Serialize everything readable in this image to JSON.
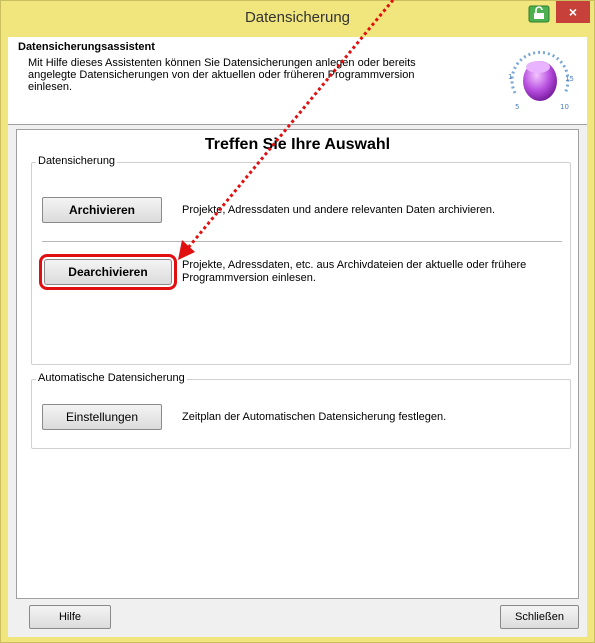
{
  "window": {
    "title": "Datensicherung",
    "close_glyph": "×"
  },
  "header": {
    "title": "Datensicherungsassistent",
    "description": "Mit Hilfe dieses Assistenten können Sie Datensicherungen anlegen oder bereits angelegte Datensicherungen von der aktuellen oder früheren Programmversion einlesen.",
    "dial_labels": [
      "1",
      "5",
      "10",
      "15"
    ]
  },
  "content": {
    "choice_title": "Treffen Sie Ihre Auswahl",
    "backup_group": {
      "legend": "Datensicherung",
      "archive_button": "Archivieren",
      "archive_desc": "Projekte, Adressdaten und andere relevanten Daten archivieren.",
      "dearchive_button": "Dearchivieren",
      "dearchive_desc": "Projekte, Adressdaten, etc. aus Archivdateien der aktuelle oder frühere Programmversion einlesen."
    },
    "auto_group": {
      "legend": "Automatische Datensicherung",
      "settings_button": "Einstellungen",
      "settings_desc": "Zeitplan der Automatischen Datensicherung festlegen."
    }
  },
  "footer": {
    "help_button": "Hilfe",
    "close_button": "Schließen"
  },
  "colors": {
    "titlebar": "#f0e67d",
    "close_button": "#c7403a",
    "annotation_red": "#e01010"
  }
}
